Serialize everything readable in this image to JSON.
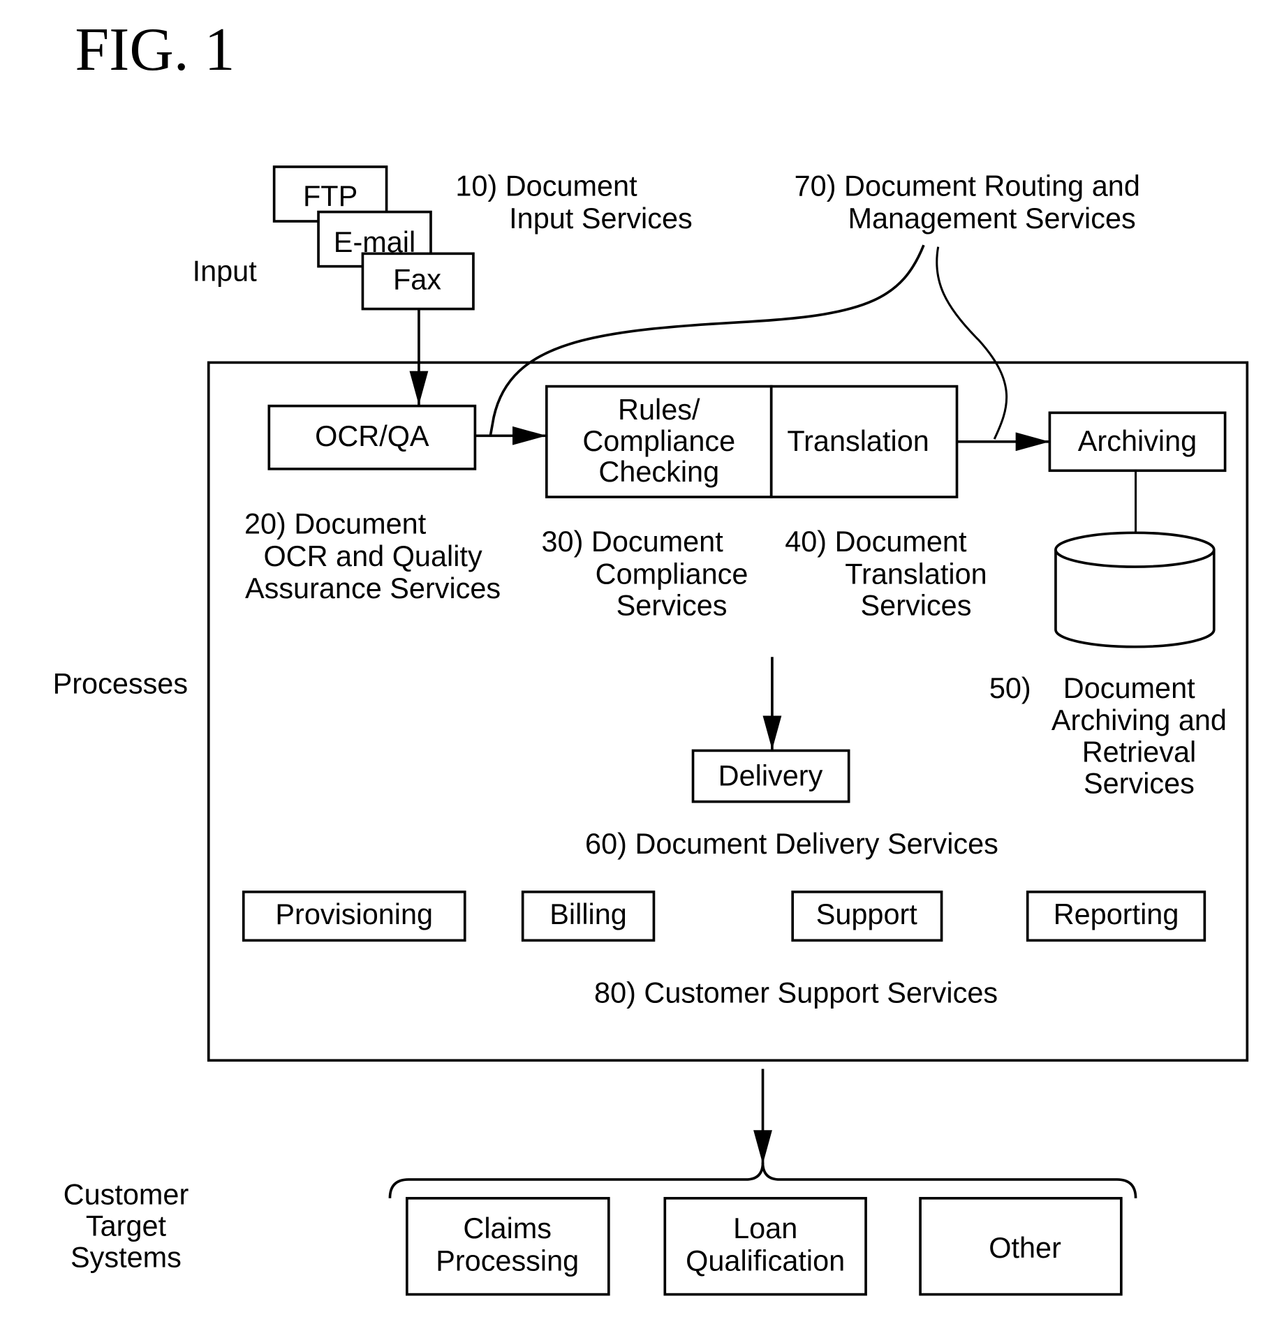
{
  "figure": {
    "title": "FIG. 1"
  },
  "side_labels": {
    "input": "Input",
    "processes": "Processes",
    "customer_target_systems": [
      "Customer",
      "Target",
      "Systems"
    ]
  },
  "input_boxes": [
    "FTP",
    "E-mail",
    "Fax"
  ],
  "process_boxes": {
    "ocr_qa": "OCR/QA",
    "rules": [
      "Rules/",
      "Compliance",
      "Checking"
    ],
    "translation": "Translation",
    "archiving": "Archiving",
    "delivery": "Delivery"
  },
  "service_labels": {
    "s10": [
      "10) Document",
      "Input Services"
    ],
    "s20": [
      "20) Document",
      "OCR and Quality",
      "Assurance Services"
    ],
    "s30": [
      "30) Document",
      "Compliance",
      "Services"
    ],
    "s40": [
      "40) Document",
      "Translation",
      "Services"
    ],
    "s50": [
      "50)    Document",
      "Archiving and",
      "Retrieval",
      "Services"
    ],
    "s60": "60) Document Delivery Services",
    "s70": [
      "70) Document Routing and",
      "Management Services"
    ],
    "s80": "80) Customer Support Services"
  },
  "support_boxes": [
    "Provisioning",
    "Billing",
    "Support",
    "Reporting"
  ],
  "target_systems": [
    [
      "Claims",
      "Processing"
    ],
    [
      "Loan",
      "Qualification"
    ],
    [
      "Other"
    ]
  ]
}
